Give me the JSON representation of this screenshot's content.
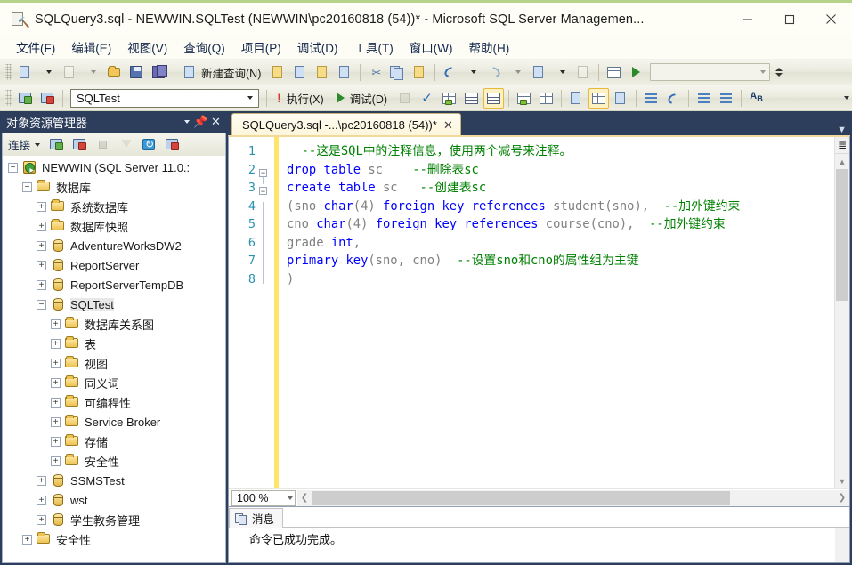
{
  "window": {
    "title": "SQLQuery3.sql - NEWWIN.SQLTest (NEWWIN\\pc20160818 (54))* - Microsoft SQL Server Managemen...",
    "icon": "sql-file-icon",
    "minimize_label": "—",
    "maximize_label": "□",
    "close_label": "✕"
  },
  "menubar": {
    "items": [
      {
        "label": "文件(F)",
        "name": "menu-file"
      },
      {
        "label": "编辑(E)",
        "name": "menu-edit"
      },
      {
        "label": "视图(V)",
        "name": "menu-view"
      },
      {
        "label": "查询(Q)",
        "name": "menu-query"
      },
      {
        "label": "项目(P)",
        "name": "menu-project"
      },
      {
        "label": "调试(D)",
        "name": "menu-debug"
      },
      {
        "label": "工具(T)",
        "name": "menu-tools"
      },
      {
        "label": "窗口(W)",
        "name": "menu-window"
      },
      {
        "label": "帮助(H)",
        "name": "menu-help"
      }
    ]
  },
  "toolbar1": {
    "new_query_label": "新建查询(N)",
    "combo_value": ""
  },
  "toolbar2": {
    "database_value": "SQLTest",
    "execute_label": "执行(X)",
    "debug_label": "调试(D)"
  },
  "object_explorer": {
    "title": "对象资源管理器",
    "connect_label": "连接",
    "tree": [
      {
        "label": "NEWWIN (SQL Server 11.0.:",
        "icon": "server-icon",
        "state": "expanded",
        "indent": 0
      },
      {
        "label": "数据库",
        "icon": "folder-icon",
        "state": "expanded",
        "indent": 1
      },
      {
        "label": "系统数据库",
        "icon": "folder-icon",
        "state": "collapsed",
        "indent": 2
      },
      {
        "label": "数据库快照",
        "icon": "folder-icon",
        "state": "collapsed",
        "indent": 2
      },
      {
        "label": "AdventureWorksDW2",
        "icon": "database-icon",
        "state": "collapsed",
        "indent": 2
      },
      {
        "label": "ReportServer",
        "icon": "database-icon",
        "state": "collapsed",
        "indent": 2
      },
      {
        "label": "ReportServerTempDB",
        "icon": "database-icon",
        "state": "collapsed",
        "indent": 2
      },
      {
        "label": "SQLTest",
        "icon": "database-icon",
        "state": "expanded",
        "indent": 2,
        "selected": true
      },
      {
        "label": "数据库关系图",
        "icon": "folder-icon",
        "state": "collapsed",
        "indent": 3
      },
      {
        "label": "表",
        "icon": "folder-icon",
        "state": "collapsed",
        "indent": 3
      },
      {
        "label": "视图",
        "icon": "folder-icon",
        "state": "collapsed",
        "indent": 3
      },
      {
        "label": "同义词",
        "icon": "folder-icon",
        "state": "collapsed",
        "indent": 3
      },
      {
        "label": "可编程性",
        "icon": "folder-icon",
        "state": "collapsed",
        "indent": 3
      },
      {
        "label": "Service Broker",
        "icon": "folder-icon",
        "state": "collapsed",
        "indent": 3
      },
      {
        "label": "存储",
        "icon": "folder-icon",
        "state": "collapsed",
        "indent": 3
      },
      {
        "label": "安全性",
        "icon": "folder-icon",
        "state": "collapsed",
        "indent": 3
      },
      {
        "label": "SSMSTest",
        "icon": "database-icon",
        "state": "collapsed",
        "indent": 2
      },
      {
        "label": "wst",
        "icon": "database-icon",
        "state": "collapsed",
        "indent": 2
      },
      {
        "label": "学生教务管理",
        "icon": "database-icon",
        "state": "collapsed",
        "indent": 2
      },
      {
        "label": "安全性",
        "icon": "folder-icon",
        "state": "collapsed",
        "indent": 1
      }
    ]
  },
  "editor": {
    "tab_label": "SQLQuery3.sql -...\\pc20160818 (54))*",
    "tab_close": "✕",
    "zoom_value": "100 %",
    "lines": [
      {
        "n": "1",
        "fold": "none",
        "tokens": [
          {
            "t": "  ",
            "c": "c-txt"
          },
          {
            "t": "--这是SQL中的注释信息，使用两个减号来注释。",
            "c": "c-com"
          }
        ]
      },
      {
        "n": "2",
        "fold": "box",
        "tokens": [
          {
            "t": "drop table ",
            "c": "c-kw"
          },
          {
            "t": "sc",
            "c": "c-gry"
          },
          {
            "t": "    ",
            "c": "c-txt"
          },
          {
            "t": "--删除表sc",
            "c": "c-com"
          }
        ]
      },
      {
        "n": "3",
        "fold": "box",
        "tokens": [
          {
            "t": "create table ",
            "c": "c-kw"
          },
          {
            "t": "sc",
            "c": "c-gry"
          },
          {
            "t": "   ",
            "c": "c-txt"
          },
          {
            "t": "--创建表sc",
            "c": "c-com"
          }
        ]
      },
      {
        "n": "4",
        "fold": "line",
        "tokens": [
          {
            "t": "(",
            "c": "c-gry"
          },
          {
            "t": "sno ",
            "c": "c-gry"
          },
          {
            "t": "char",
            "c": "c-kw"
          },
          {
            "t": "(4) ",
            "c": "c-gry"
          },
          {
            "t": "foreign key references ",
            "c": "c-kw"
          },
          {
            "t": "student(sno),",
            "c": "c-gry"
          },
          {
            "t": "  ",
            "c": "c-txt"
          },
          {
            "t": "--加外键约束",
            "c": "c-com"
          }
        ]
      },
      {
        "n": "5",
        "fold": "line",
        "tokens": [
          {
            "t": "cno ",
            "c": "c-gry"
          },
          {
            "t": "char",
            "c": "c-kw"
          },
          {
            "t": "(4) ",
            "c": "c-gry"
          },
          {
            "t": "foreign key references ",
            "c": "c-kw"
          },
          {
            "t": "course(cno),",
            "c": "c-gry"
          },
          {
            "t": "  ",
            "c": "c-txt"
          },
          {
            "t": "--加外键约束",
            "c": "c-com"
          }
        ]
      },
      {
        "n": "6",
        "fold": "line",
        "tokens": [
          {
            "t": "grade ",
            "c": "c-gry"
          },
          {
            "t": "int",
            "c": "c-kw"
          },
          {
            "t": ",",
            "c": "c-gry"
          }
        ]
      },
      {
        "n": "7",
        "fold": "line",
        "tokens": [
          {
            "t": "primary key",
            "c": "c-kw"
          },
          {
            "t": "(sno, cno)",
            "c": "c-gry"
          },
          {
            "t": "  ",
            "c": "c-txt"
          },
          {
            "t": "--设置sno和cno的属性组为主键",
            "c": "c-com"
          }
        ]
      },
      {
        "n": "8",
        "fold": "end",
        "tokens": [
          {
            "t": ")",
            "c": "c-gry"
          }
        ]
      }
    ]
  },
  "results": {
    "tab_label": "消息",
    "message": "命令已成功完成。"
  },
  "colors": {
    "accent_green": "#b5d38a",
    "panel_blue": "#2c3e5c",
    "comment_green": "#008000",
    "keyword_blue": "#0000ff",
    "linenum_teal": "#2b91af",
    "tab_yellow": "#f0d99a",
    "highlight_yellow": "#fff2c2"
  }
}
